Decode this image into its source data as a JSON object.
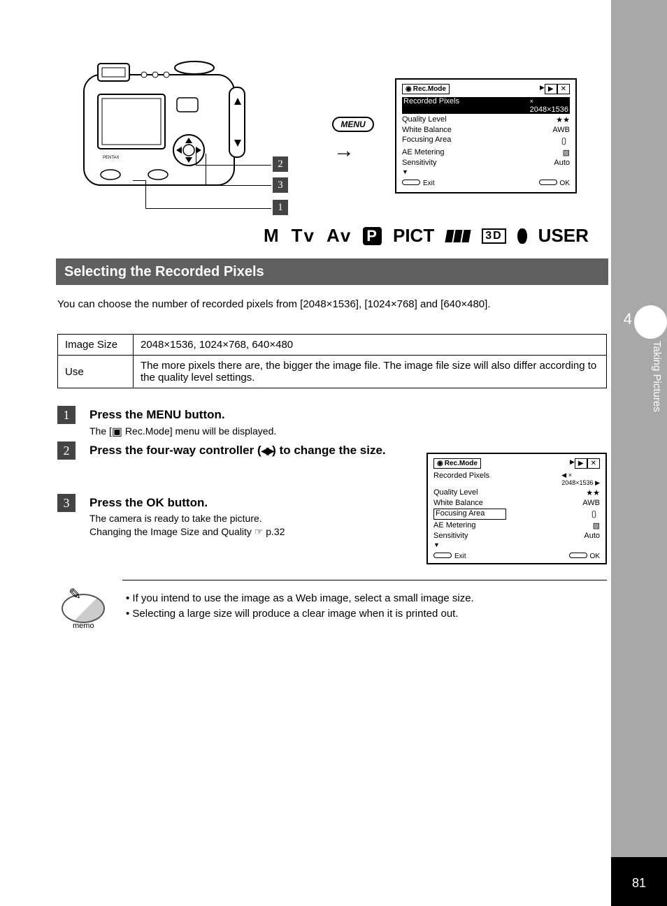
{
  "page_number": "81",
  "side_tab": {
    "number": "4",
    "caption": "Taking Pictures"
  },
  "menu_button_label": "MENU",
  "mode_strip": {
    "m": "M",
    "tv": "Tv",
    "av": "Av",
    "pict": "PICT",
    "td": "3D",
    "user": "USER"
  },
  "section_title": "Selecting the Recorded Pixels",
  "intro_text": "You can choose the number of recorded pixels from [2048×1536], [1024×768] and [640×480].",
  "table": {
    "r1c1": "Image Size",
    "r1c2": "2048×1536, 1024×768, 640×480",
    "r2c1": "Use",
    "r2c2": "The more pixels there are, the bigger the image file. The image file size will also differ according to the quality level settings."
  },
  "steps": {
    "s1": {
      "pre": "Press the MENU button.",
      "post": "The [",
      "tail": "Rec.Mode] menu will be displayed."
    },
    "s2": {
      "pre": "Press the four-way controller (",
      "post": ") to change the size."
    },
    "s3": {
      "main": "Press the OK button.",
      "sub1": "The camera is ready to take the picture.",
      "sub2": "Changing the Image Size and Quality ☞ p.32"
    }
  },
  "lcd_main": {
    "tab_active": "Rec.Mode",
    "rows": [
      {
        "label": "Recorded Pixels",
        "value": "2048×1536"
      },
      {
        "label": "Quality Level",
        "value": "★★"
      },
      {
        "label": "White Balance",
        "value": "AWB"
      },
      {
        "label": "Focusing Area",
        "value": ""
      },
      {
        "label": "AE Metering",
        "value": ""
      },
      {
        "label": "Sensitivity",
        "value": "Auto"
      }
    ],
    "foot_left": "Exit",
    "foot_right": "OK"
  },
  "lcd_step": {
    "tab_active": "Rec.Mode",
    "rows": [
      {
        "label": "Recorded Pixels",
        "value": "2048×1536"
      },
      {
        "label": "Quality Level",
        "value": "★★"
      },
      {
        "label": "White Balance",
        "value": "AWB"
      },
      {
        "label": "Focusing Area",
        "value": ""
      },
      {
        "label": "AE Metering",
        "value": ""
      },
      {
        "label": "Sensitivity",
        "value": "Auto"
      }
    ],
    "foot_left": "Exit",
    "foot_right": "OK"
  },
  "memo": {
    "label": "memo",
    "text": "• If you intend to use the image as a Web image, select a small image size.\n• Selecting a large size will produce a clear image when it is printed out."
  },
  "callouts": {
    "one": "1",
    "two": "2",
    "three": "3"
  }
}
